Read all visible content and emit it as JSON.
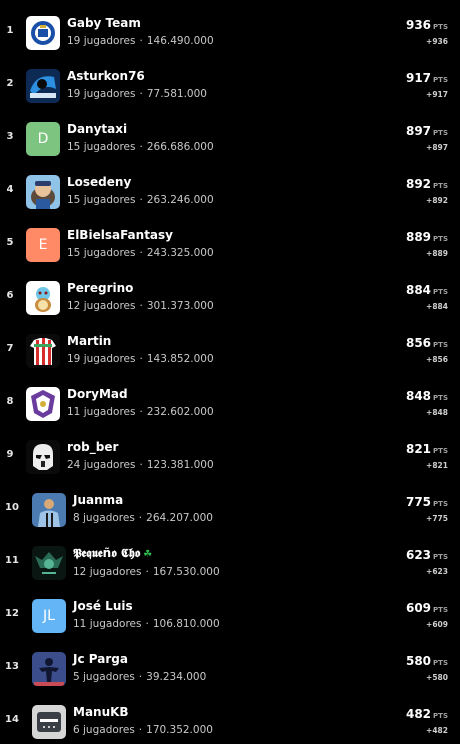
{
  "ranking": [
    {
      "rank": "1",
      "name": "Gaby Team",
      "players": "19 jugadores",
      "sep": "·",
      "value": "146.490.000",
      "points": "936",
      "unit": "PTS",
      "delta": "+936",
      "avatar_type": "crest-icon"
    },
    {
      "rank": "2",
      "name": "Asturkon76",
      "players": "19 jugadores",
      "sep": "·",
      "value": "77.581.000",
      "points": "917",
      "unit": "PTS",
      "delta": "+917",
      "avatar_type": "logo-icon"
    },
    {
      "rank": "3",
      "name": "Danytaxi",
      "players": "15 jugadores",
      "sep": "·",
      "value": "266.686.000",
      "points": "897",
      "unit": "PTS",
      "delta": "+897",
      "avatar_letter": "D",
      "avatar_color": "#7cc47f"
    },
    {
      "rank": "4",
      "name": "Losedeny",
      "players": "15 jugadores",
      "sep": "·",
      "value": "263.246.000",
      "points": "892",
      "unit": "PTS",
      "delta": "+892",
      "avatar_type": "cartoon-icon"
    },
    {
      "rank": "5",
      "name": "ElBielsaFantasy",
      "players": "15 jugadores",
      "sep": "·",
      "value": "243.325.000",
      "points": "889",
      "unit": "PTS",
      "delta": "+889",
      "avatar_letter": "E",
      "avatar_color": "#ff8a65"
    },
    {
      "rank": "6",
      "name": "Peregrino",
      "players": "12 jugadores",
      "sep": "·",
      "value": "301.373.000",
      "points": "884",
      "unit": "PTS",
      "delta": "+884",
      "avatar_type": "squirtle-icon"
    },
    {
      "rank": "7",
      "name": "Martin",
      "players": "19 jugadores",
      "sep": "·",
      "value": "143.852.000",
      "points": "856",
      "unit": "PTS",
      "delta": "+856",
      "avatar_type": "jersey-icon"
    },
    {
      "rank": "8",
      "name": "DoryMad",
      "players": "11 jugadores",
      "sep": "·",
      "value": "232.602.000",
      "points": "848",
      "unit": "PTS",
      "delta": "+848",
      "avatar_type": "shield-icon"
    },
    {
      "rank": "9",
      "name": "rob_ber",
      "players": "24 jugadores",
      "sep": "·",
      "value": "123.381.000",
      "points": "821",
      "unit": "PTS",
      "delta": "+821",
      "avatar_type": "trooper-icon"
    },
    {
      "rank": "10",
      "name": "Juanma",
      "players": "8 jugadores",
      "sep": "·",
      "value": "264.207.000",
      "points": "775",
      "unit": "PTS",
      "delta": "+775",
      "avatar_type": "player-photo-icon"
    },
    {
      "rank": "11",
      "name": "𝕻𝖊𝖖𝖚𝖊ñ𝖔 𝕮𝖍𝖔",
      "players": "12 jugadores",
      "sep": "·",
      "value": "167.530.000",
      "points": "623",
      "unit": "PTS",
      "delta": "+623",
      "avatar_type": "dark-emblem-icon",
      "badge": "☘"
    },
    {
      "rank": "12",
      "name": "José Luis",
      "players": "11 jugadores",
      "sep": "·",
      "value": "106.810.000",
      "points": "609",
      "unit": "PTS",
      "delta": "+609",
      "avatar_letter": "JL",
      "avatar_color": "#64b5f6"
    },
    {
      "rank": "13",
      "name": "Jc Parga",
      "players": "5 jugadores",
      "sep": "·",
      "value": "39.234.000",
      "points": "580",
      "unit": "PTS",
      "delta": "+580",
      "avatar_type": "silhouette-icon"
    },
    {
      "rank": "14",
      "name": "ManuKB",
      "players": "6 jugadores",
      "sep": "·",
      "value": "170.352.000",
      "points": "482",
      "unit": "PTS",
      "delta": "+482",
      "avatar_type": "badge-icon"
    }
  ],
  "colors": {
    "background": "#000000",
    "text": "#ffffff",
    "muted": "#c8c8c8",
    "unit": "#a0a0a0"
  }
}
